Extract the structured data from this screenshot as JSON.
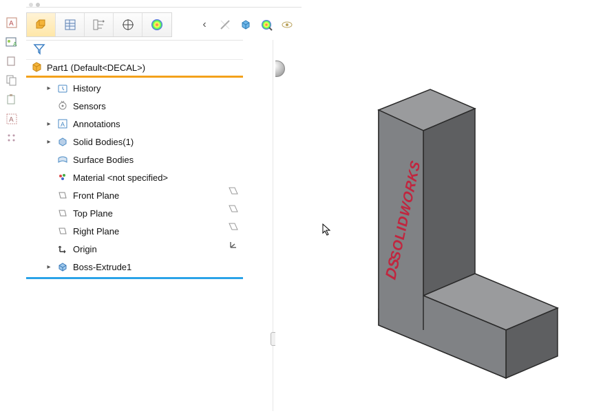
{
  "app": "SolidWorks",
  "left_tools": [
    "image-a-icon",
    "drawing-ref-icon",
    "layer-icon",
    "section-icon",
    "clipboard-icon",
    "text-tool-icon",
    "pattern-tool-icon"
  ],
  "top_tabs": [
    {
      "name": "feature-manager",
      "active": true
    },
    {
      "name": "property-manager"
    },
    {
      "name": "config-manager"
    },
    {
      "name": "dimxpert-manager"
    },
    {
      "name": "display-manager"
    }
  ],
  "view_tools": [
    "back",
    "hide",
    "view-cube",
    "appearance",
    "visibility"
  ],
  "tree": {
    "root": "Part1  (Default<DECAL>)",
    "items": [
      {
        "label": "History",
        "icon": "history-icon",
        "expandable": true
      },
      {
        "label": "Sensors",
        "icon": "sensors-icon",
        "expandable": false
      },
      {
        "label": "Annotations",
        "icon": "annotations-icon",
        "expandable": true
      },
      {
        "label": "Solid Bodies(1)",
        "icon": "solid-bodies-icon",
        "expandable": true
      },
      {
        "label": "Surface Bodies",
        "icon": "surface-bodies-icon",
        "expandable": false
      },
      {
        "label": "Material <not specified>",
        "icon": "material-icon",
        "expandable": false
      },
      {
        "label": "Front Plane",
        "icon": "plane-icon",
        "expandable": false
      },
      {
        "label": "Top Plane",
        "icon": "plane-icon",
        "expandable": false
      },
      {
        "label": "Right Plane",
        "icon": "plane-icon",
        "expandable": false
      },
      {
        "label": "Origin",
        "icon": "origin-icon",
        "expandable": false
      },
      {
        "label": "Boss-Extrude1",
        "icon": "extrude-icon",
        "expandable": true
      }
    ]
  },
  "decal_text": "SOLIDWORKS",
  "decal_prefix": "DS",
  "decal_color": "#c0263f",
  "model_color": "#808285",
  "model_color_dark": "#5e5f61",
  "model_color_light": "#9a9b9d",
  "accent_orange": "#f3a11a",
  "accent_blue": "#2aa3e8"
}
